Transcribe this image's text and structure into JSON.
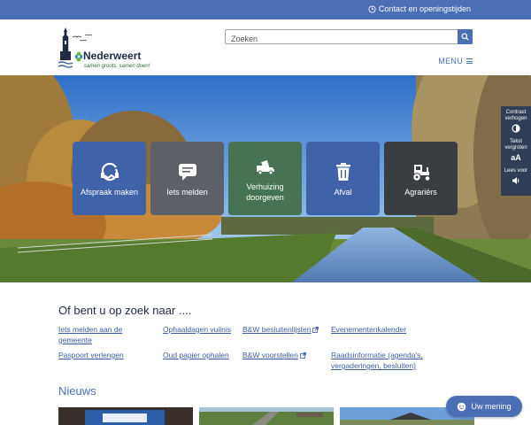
{
  "topbar": {
    "contact_label": "Contact en openingstijden"
  },
  "header": {
    "logo_title": "Nederweert",
    "logo_tagline": "samen groots, samen doen!",
    "search_placeholder": "Zoeken",
    "menu_label": "MENU"
  },
  "tiles": [
    {
      "label": "Afspraak maken",
      "color": "#3f63a8",
      "icon": "handshake-icon"
    },
    {
      "label": "Iets melden",
      "color": "#5d6167",
      "icon": "chat-icon"
    },
    {
      "label": "Verhuizing doorgeven",
      "color": "#467354",
      "icon": "moving-truck-icon"
    },
    {
      "label": "Afval",
      "color": "#3f63a8",
      "icon": "trash-icon"
    },
    {
      "label": "Agrariërs",
      "color": "#3a3d42",
      "icon": "tractor-icon"
    }
  ],
  "a11y": {
    "contrast_label": "Contrast verhogen",
    "text_size_label": "Tekst vergroten",
    "text_size_icon": "aA",
    "read_aloud_label": "Lees voor"
  },
  "links_section": {
    "title": "Of bent u op zoek naar ....",
    "col1": [
      "Iets melden aan de",
      "gemeente",
      "Paspoort verlengen"
    ],
    "col2": [
      "Ophaaldagen vuilnis",
      "Oud papier ophalen"
    ],
    "col3": [
      "B&W besluitenlijsten",
      "B&W voorstellen"
    ],
    "col4": [
      "Evenementenkalender",
      "Raadsinformatie (agenda's,",
      "vergaderingen, besluiten)"
    ]
  },
  "news": {
    "title": "Nieuws"
  },
  "feedback": {
    "label": "Uw mening"
  }
}
